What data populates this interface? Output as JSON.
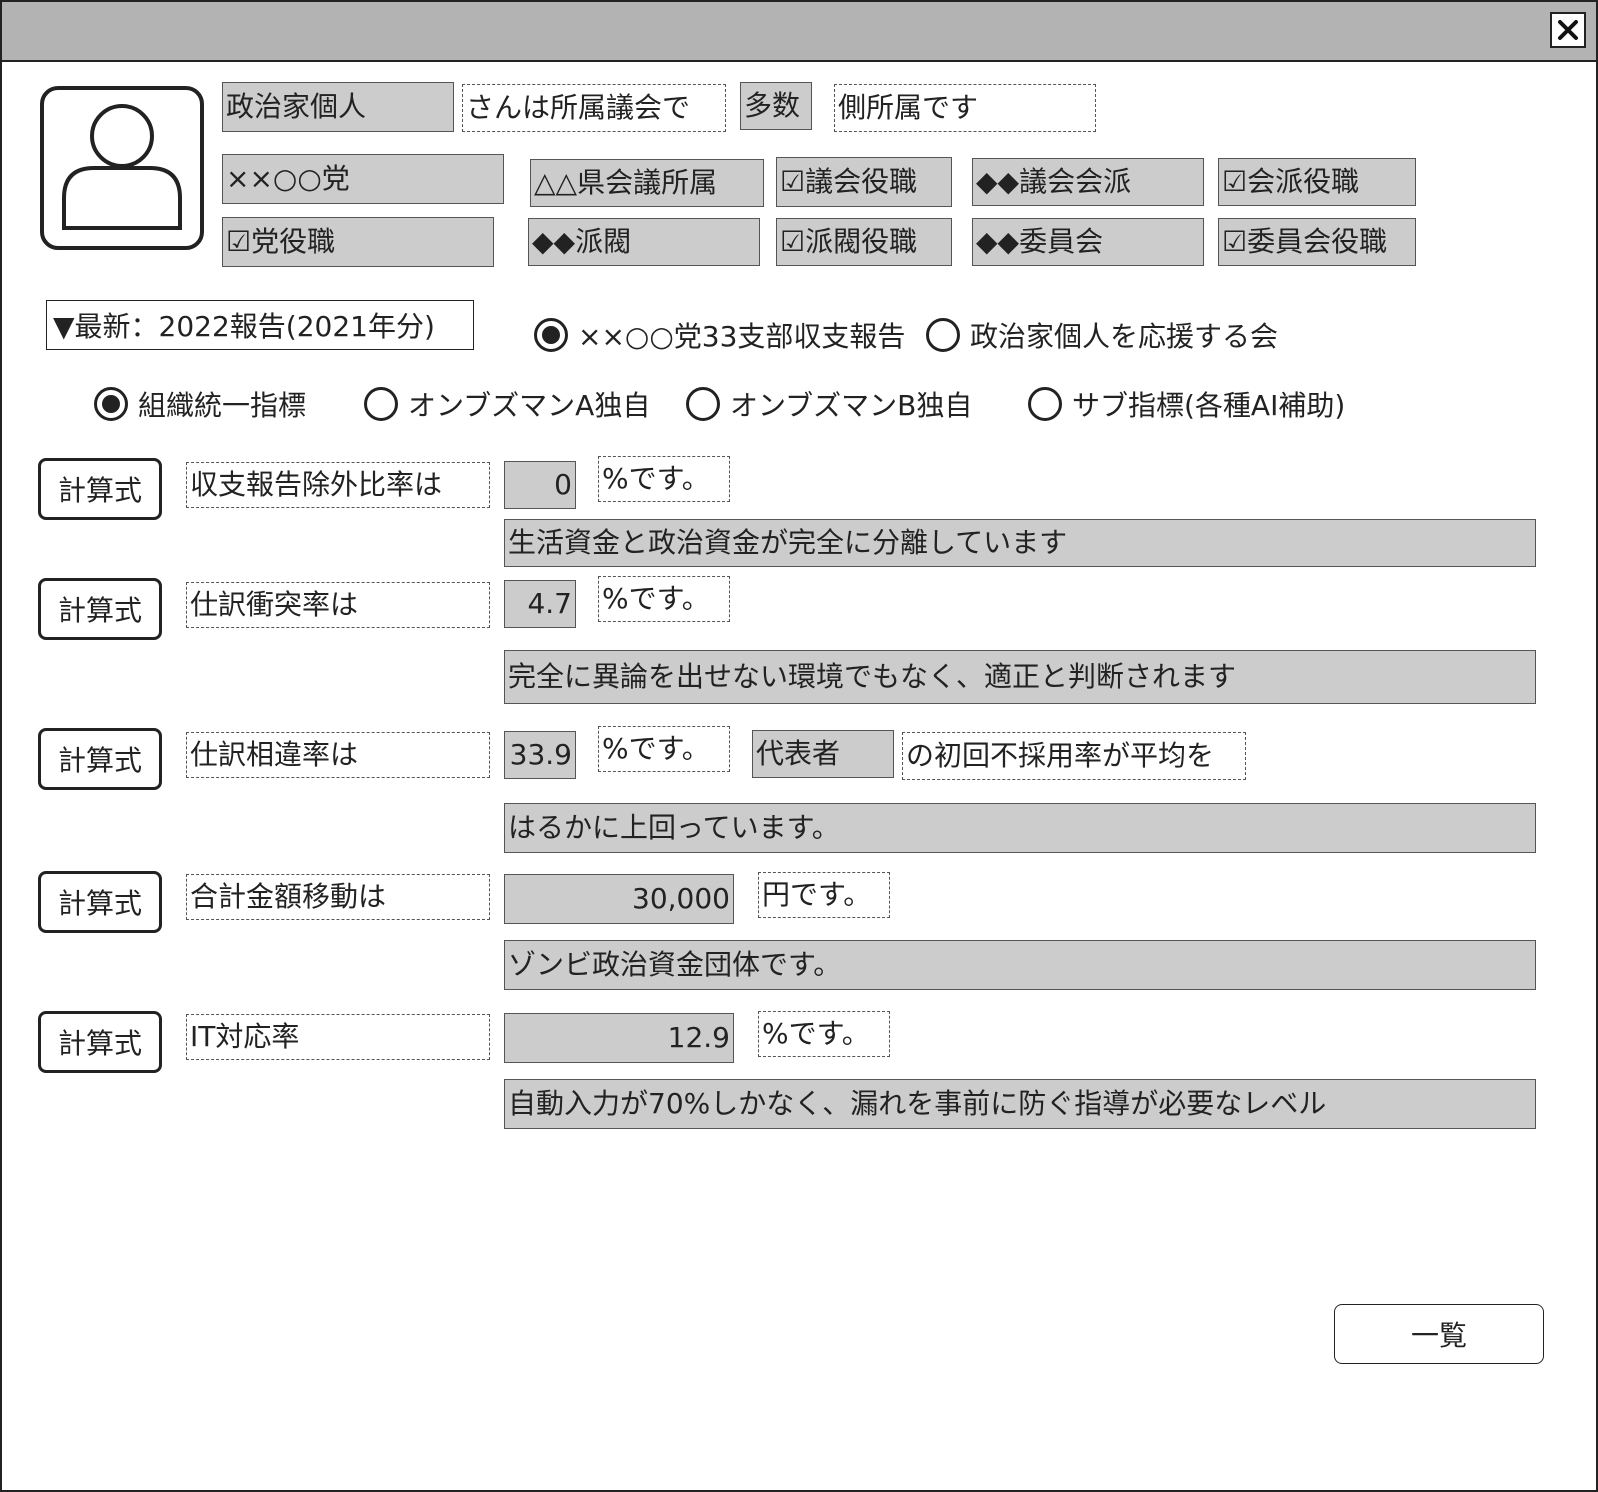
{
  "window": {
    "close_glyph": "✕"
  },
  "profile": {
    "name": "政治家個人",
    "phrase1": "さんは所属議会で",
    "majority": "多数",
    "phrase2": "側所属です",
    "party": "××○○党",
    "tags_row1": [
      "△△県会議所属",
      "☑議会役職",
      "◆◆議会会派",
      "☑会派役職"
    ],
    "tags_row2": [
      "☑党役職",
      "◆◆派閥",
      "☑派閥役職",
      "◆◆委員会",
      "☑委員会役職"
    ]
  },
  "report_select": {
    "value": "▼最新：2022報告(2021年分)"
  },
  "source_radios": [
    {
      "label": "××○○党33支部収支報告",
      "selected": true
    },
    {
      "label": "政治家個人を応援する会",
      "selected": false
    }
  ],
  "index_radios": [
    {
      "label": "組織統一指標",
      "selected": true
    },
    {
      "label": "オンブズマンA独自",
      "selected": false
    },
    {
      "label": "オンブズマンB独自",
      "selected": false
    },
    {
      "label": "サブ指標(各種AI補助)",
      "selected": false
    }
  ],
  "metrics": [
    {
      "button": "計算式",
      "label": "収支報告除外比率は",
      "value": "0",
      "unit": "%です。",
      "comment": "生活資金と政治資金が完全に分離しています"
    },
    {
      "button": "計算式",
      "label": "仕訳衝突率は",
      "value": "4.7",
      "unit": "%です。",
      "comment": "完全に異論を出せない環境でもなく、適正と判断されます"
    },
    {
      "button": "計算式",
      "label": "仕訳相違率は",
      "value": "33.9",
      "unit": "%です。",
      "extra_field": "代表者",
      "extra_text": "の初回不採用率が平均を",
      "comment": "はるかに上回っています。"
    },
    {
      "button": "計算式",
      "label": "合計金額移動は",
      "value": "30,000",
      "unit": "円です。",
      "comment": "ゾンビ政治資金団体です。"
    },
    {
      "button": "計算式",
      "label": "IT対応率",
      "value": "12.9",
      "unit": "%です。",
      "comment": "自動入力が70%しかなく、漏れを事前に防ぐ指導が必要なレベル"
    }
  ],
  "footer": {
    "list_button": "一覧"
  },
  "colors": {
    "titlebar": "#b3b3b3",
    "field_gray": "#cccccc",
    "border": "#222222"
  }
}
